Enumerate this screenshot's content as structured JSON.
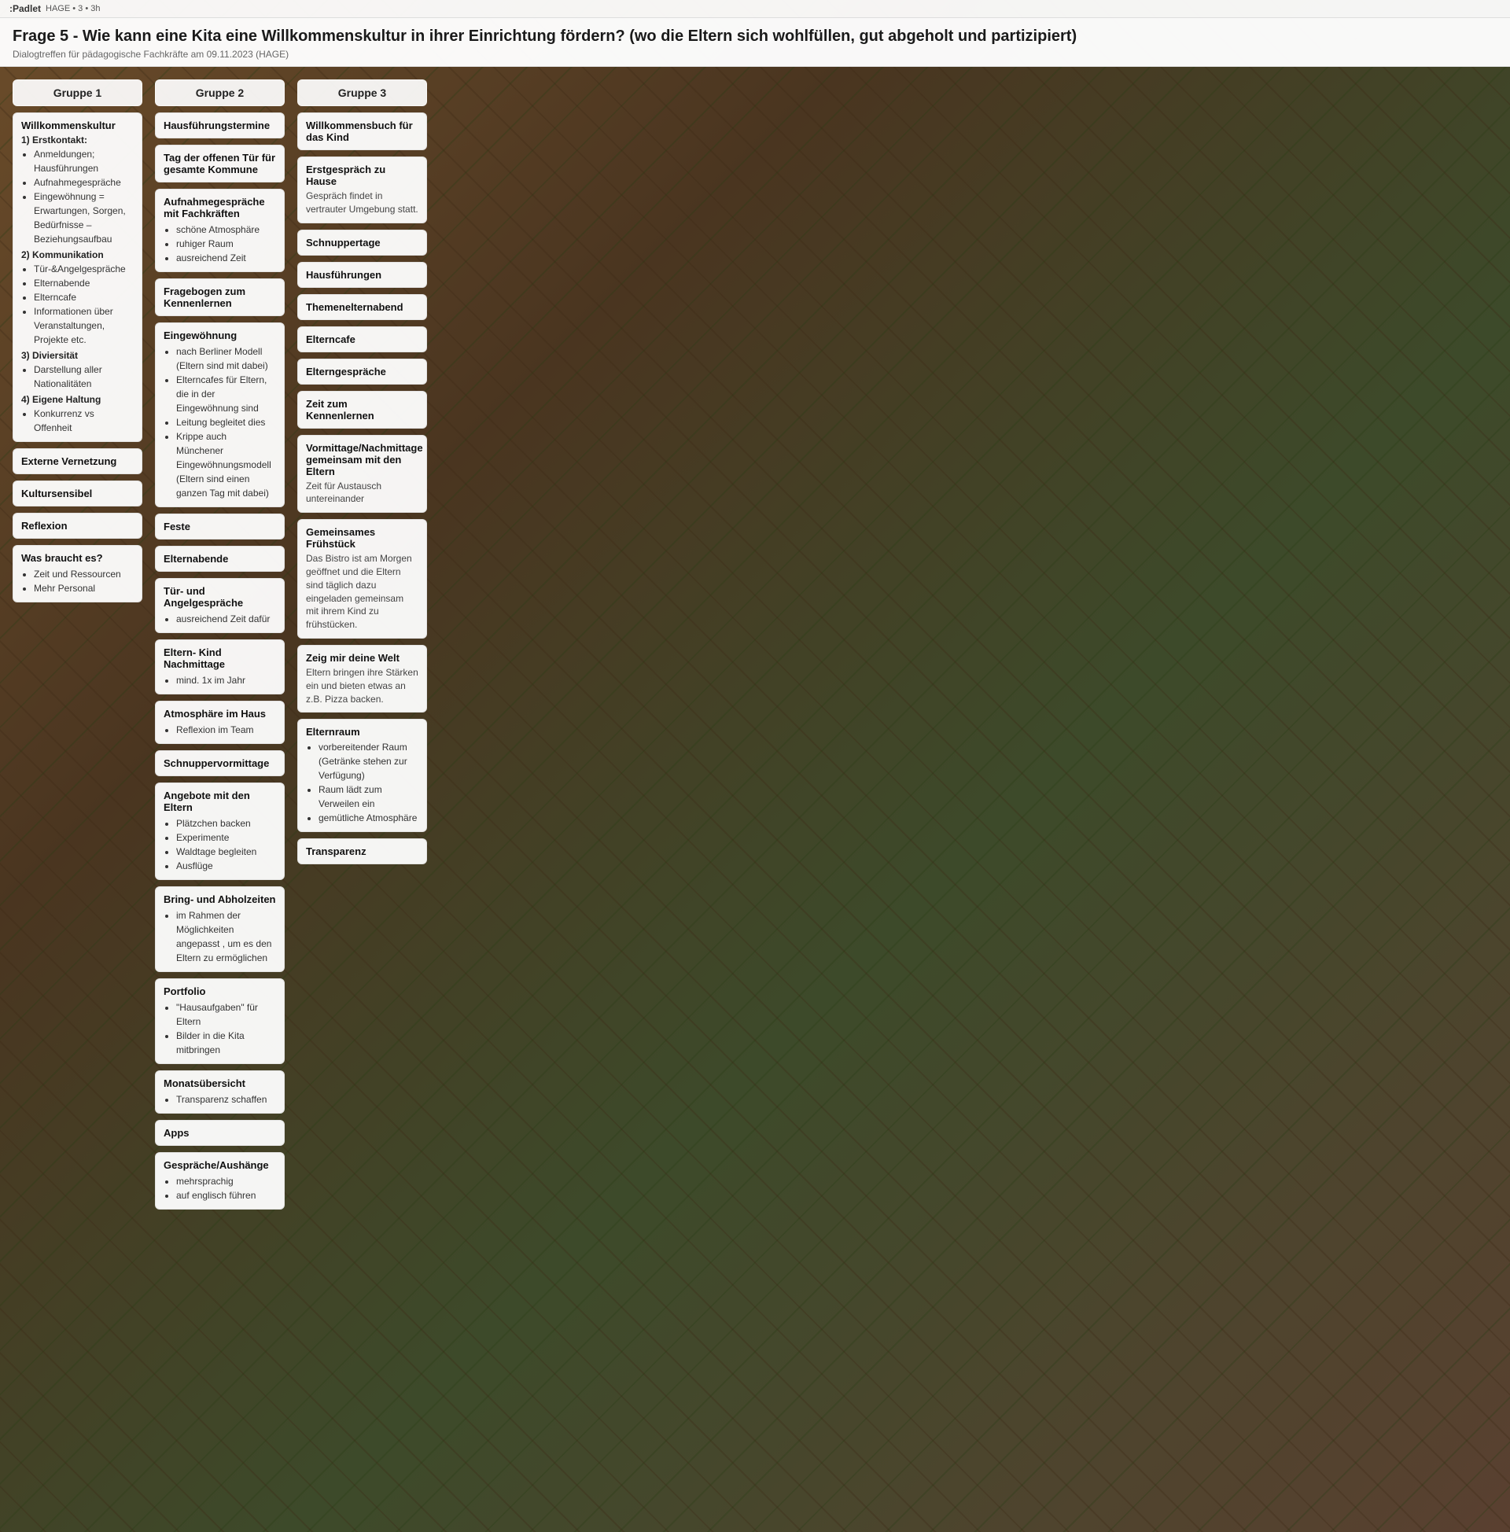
{
  "topBar": {
    "logo": ":Padlet",
    "breadcrumb": "HAGE • 3 • 3h"
  },
  "header": {
    "title": "Frage 5 - Wie kann eine Kita eine Willkommenskultur in ihrer Einrichtung fördern? (wo die Eltern sich wohlfüllen, gut abgeholt und partizipiert)",
    "subtitle": "Dialogtreffen für pädagogische Fachkräfte am 09.11.2023 (HAGE)"
  },
  "columns": [
    {
      "id": "gruppe1",
      "header": "Gruppe 1",
      "cards": [
        {
          "type": "content",
          "title": "Willkommenskultur",
          "sections": [
            {
              "label": "1) Erstkontakt:",
              "items": [
                "Anmeldungen; Hausführungen",
                "Aufnahmegespräche"
              ]
            },
            {
              "label": "",
              "items": [
                "Eingewöhnung = Erwartungen, Sorgen, Bedürfnisse – Beziehungsaufbau"
              ]
            },
            {
              "label": "2) Kommunikation",
              "items": [
                "Tür-&Angelgespräche",
                "Elternabende",
                "Elterncafe",
                "Informationen über Veranstaltungen, Projekte etc."
              ]
            },
            {
              "label": "3) Diviersität",
              "items": [
                "Darstellung aller Nationalitäten"
              ]
            },
            {
              "label": "4) Eigene Haltung",
              "items": [
                "Konkurrenz vs Offenheit"
              ]
            }
          ]
        },
        {
          "type": "simple",
          "title": "Externe Vernetzung"
        },
        {
          "type": "simple",
          "title": "Kultursensibel"
        },
        {
          "type": "simple",
          "title": "Reflexion"
        },
        {
          "type": "content",
          "title": "Was braucht es?",
          "sections": [
            {
              "label": "",
              "items": [
                "Zeit und Ressourcen",
                "Mehr Personal"
              ]
            }
          ]
        }
      ]
    },
    {
      "id": "gruppe2",
      "header": "Gruppe 2",
      "cards": [
        {
          "type": "simple",
          "title": "Hausführungstermine"
        },
        {
          "type": "simple",
          "title": "Tag der offenen Tür für gesamte Kommune"
        },
        {
          "type": "content-list",
          "title": "Aufnahmegespräche mit Fachkräften",
          "items": [
            "schöne Atmosphäre",
            "ruhiger Raum",
            "ausreichend Zeit"
          ]
        },
        {
          "type": "simple",
          "title": "Fragebogen zum Kennenlernen"
        },
        {
          "type": "content-list",
          "title": "Eingewöhnung",
          "items": [
            "nach Berliner Modell (Eltern sind mit dabei)",
            "Elterncafes für Eltern, die in der Eingewöhnung sind",
            "Leitung begleitet dies",
            "Krippe auch Münchener Eingewöhnungsmodell (Eltern sind einen ganzen Tag mit dabei)"
          ]
        },
        {
          "type": "simple",
          "title": "Feste"
        },
        {
          "type": "simple",
          "title": "Elternabende"
        },
        {
          "type": "content-list",
          "title": "Tür- und Angelgespräche",
          "items": [
            "ausreichend Zeit dafür"
          ]
        },
        {
          "type": "content-list",
          "title": "Eltern- Kind Nachmittage",
          "items": [
            "mind. 1x im Jahr"
          ]
        },
        {
          "type": "content-list",
          "title": "Atmosphäre im Haus",
          "items": [
            "Reflexion im Team"
          ]
        },
        {
          "type": "simple",
          "title": "Schnuppervormittage"
        },
        {
          "type": "content-list",
          "title": "Angebote mit den Eltern",
          "items": [
            "Plätzchen backen",
            "Experimente",
            "Waldtage begleiten",
            "Ausflüge"
          ]
        },
        {
          "type": "content-list",
          "title": "Bring- und Abholzeiten",
          "items": [
            "im Rahmen der Möglichkeiten angepasst , um es den Eltern zu ermöglichen"
          ]
        },
        {
          "type": "content-list",
          "title": "Portfolio",
          "items": [
            "\"Hausaufgaben\" für Eltern",
            "Bilder in die Kita mitbringen"
          ]
        },
        {
          "type": "content-list",
          "title": "Monatsübersicht",
          "items": [
            "Transparenz schaffen"
          ]
        },
        {
          "type": "simple",
          "title": "Apps"
        },
        {
          "type": "content-list",
          "title": "Gespräche/Aushänge",
          "items": [
            "mehrsprachig",
            "auf englisch führen"
          ]
        }
      ]
    },
    {
      "id": "gruppe3",
      "header": "Gruppe 3",
      "cards": [
        {
          "type": "simple",
          "title": "Willkommensbuch für das Kind"
        },
        {
          "type": "desc",
          "title": "Erstgespräch zu Hause",
          "desc": "Gespräch findet in vertrauter Umgebung statt."
        },
        {
          "type": "simple",
          "title": "Schnuppertage"
        },
        {
          "type": "simple",
          "title": "Hausführungen"
        },
        {
          "type": "simple",
          "title": "Themenelternabend"
        },
        {
          "type": "simple",
          "title": "Elterncafe"
        },
        {
          "type": "simple",
          "title": "Elterngespräche"
        },
        {
          "type": "simple",
          "title": "Zeit zum Kennenlernen"
        },
        {
          "type": "desc",
          "title": "Vormittage/Nachmittage gemeinsam mit den Eltern",
          "desc": "Zeit für Austausch untereinander"
        },
        {
          "type": "desc",
          "title": "Gemeinsames Frühstück",
          "desc": "Das Bistro ist am Morgen geöffnet und die Eltern sind täglich dazu eingeladen gemeinsam mit ihrem Kind zu frühstücken."
        },
        {
          "type": "desc",
          "title": "Zeig mir deine Welt",
          "desc": "Eltern bringen ihre Stärken ein und bieten etwas an z.B. Pizza backen."
        },
        {
          "type": "list-desc",
          "title": "Elternraum",
          "items": [
            "vorbereitender Raum (Getränke stehen zur Verfügung)",
            "Raum lädt zum Verweilen ein",
            "gemütliche Atmosphäre"
          ]
        },
        {
          "type": "simple",
          "title": "Transparenz"
        }
      ]
    }
  ]
}
